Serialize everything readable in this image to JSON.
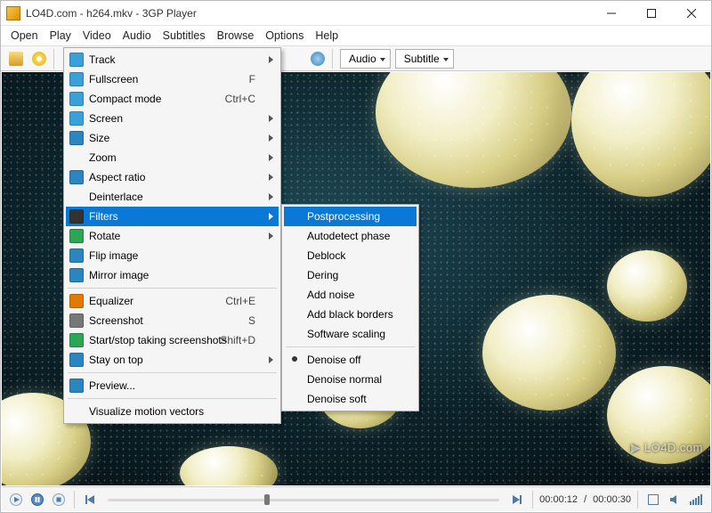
{
  "window": {
    "title": "LO4D.com - h264.mkv - 3GP Player"
  },
  "menubar": [
    "Open",
    "Play",
    "Video",
    "Audio",
    "Subtitles",
    "Browse",
    "Options",
    "Help"
  ],
  "toolbar": {
    "audio_label": "Audio",
    "subtitle_label": "Subtitle"
  },
  "video_menu": [
    {
      "label": "Track",
      "submenu": true
    },
    {
      "label": "Fullscreen",
      "shortcut": "F"
    },
    {
      "label": "Compact mode",
      "shortcut": "Ctrl+C"
    },
    {
      "label": "Screen",
      "submenu": true
    },
    {
      "label": "Size",
      "submenu": true
    },
    {
      "label": "Zoom",
      "submenu": true
    },
    {
      "label": "Aspect ratio",
      "submenu": true
    },
    {
      "label": "Deinterlace",
      "submenu": true
    },
    {
      "label": "Filters",
      "submenu": true,
      "selected": true
    },
    {
      "label": "Rotate",
      "submenu": true
    },
    {
      "label": "Flip image"
    },
    {
      "label": "Mirror image"
    },
    {
      "sep": true
    },
    {
      "label": "Equalizer",
      "shortcut": "Ctrl+E"
    },
    {
      "label": "Screenshot",
      "shortcut": "S"
    },
    {
      "label": "Start/stop taking screenshots",
      "shortcut": "Shift+D"
    },
    {
      "label": "Stay on top",
      "submenu": true
    },
    {
      "sep": true
    },
    {
      "label": "Preview..."
    },
    {
      "sep": true
    },
    {
      "label": "Visualize motion vectors"
    }
  ],
  "filters_submenu": [
    {
      "label": "Postprocessing",
      "selected": true
    },
    {
      "label": "Autodetect phase"
    },
    {
      "label": "Deblock"
    },
    {
      "label": "Dering"
    },
    {
      "label": "Add noise"
    },
    {
      "label": "Add black borders"
    },
    {
      "label": "Software scaling"
    },
    {
      "sep": true
    },
    {
      "label": "Denoise off",
      "checked": true
    },
    {
      "label": "Denoise normal"
    },
    {
      "label": "Denoise soft"
    }
  ],
  "time": {
    "current": "00:00:12",
    "total": "00:00:30",
    "progress_pct": 40
  },
  "watermark": "▶ LO4D.com"
}
